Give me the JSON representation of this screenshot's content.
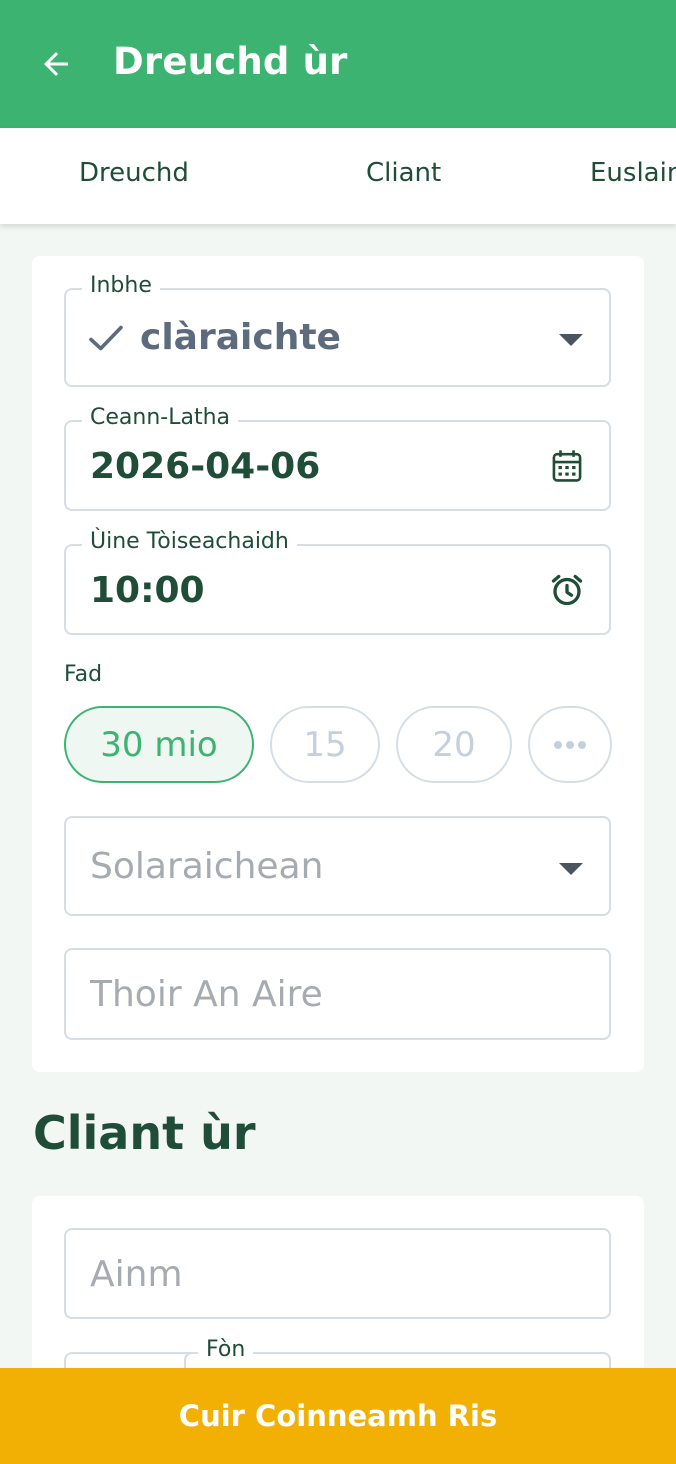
{
  "header": {
    "title": "Dreuchd ùr",
    "back_icon": "arrow-left-icon"
  },
  "tabs": [
    {
      "label": "Dreuchd"
    },
    {
      "label": "Cliant"
    },
    {
      "label": "Euslain"
    }
  ],
  "appointment": {
    "status": {
      "label": "Inbhe",
      "value": "clàraichte",
      "icon": "check-icon"
    },
    "date": {
      "label": "Ceann-Latha",
      "value": "2026-04-06",
      "icon": "calendar-icon"
    },
    "start_time": {
      "label": "Ùine Tòiseachaidh",
      "value": "10:00",
      "icon": "alarm-clock-icon"
    },
    "duration": {
      "label": "Fad",
      "options": [
        "30 mio",
        "15",
        "20"
      ],
      "selected": "30 mio",
      "more_icon": "more-horizontal-icon"
    },
    "providers": {
      "placeholder": "Solaraichean"
    },
    "notes": {
      "placeholder": "Thoir An Aire"
    }
  },
  "new_client": {
    "title": "Cliant ùr",
    "name": {
      "placeholder": "Ainm"
    },
    "phone": {
      "label": "Fòn"
    }
  },
  "footer": {
    "button_label": "Cuir Coinneamh Ris"
  },
  "colors": {
    "primary": "#3cb371",
    "accent": "#f2b005",
    "text_dark": "#1f4d38",
    "placeholder": "#a6abb1"
  }
}
